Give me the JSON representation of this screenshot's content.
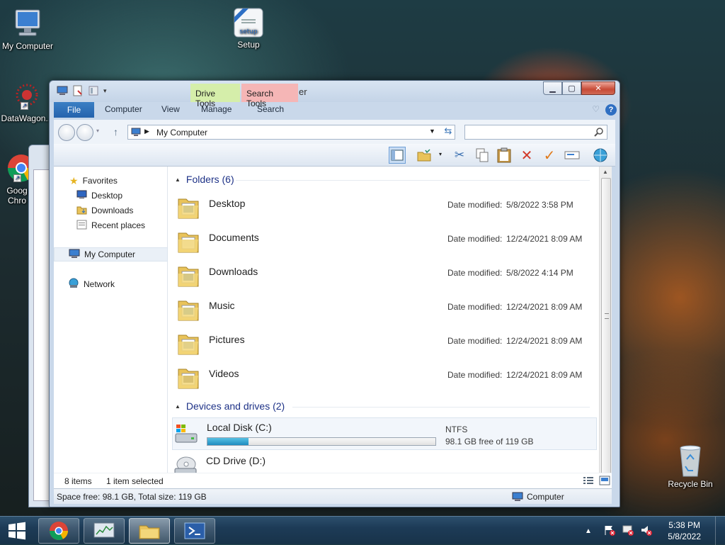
{
  "desktop": {
    "icons": [
      {
        "label": "My Computer"
      },
      {
        "label": "Setup",
        "badge": "setup"
      },
      {
        "label": "DataWagon..."
      },
      {
        "label": "Goog Chro"
      },
      {
        "label": "Recycle Bin"
      }
    ]
  },
  "window": {
    "title_fragment": "er",
    "context_tabs": {
      "drive_tools": "Drive Tools",
      "search_tools": "Search Tools"
    },
    "ribbon_tabs": [
      "File",
      "Computer",
      "View",
      "Manage",
      "Search"
    ],
    "help_label": "?",
    "address": {
      "path": "My Computer"
    },
    "search": {
      "placeholder": ""
    },
    "nav": {
      "favorites": "Favorites",
      "desktop": "Desktop",
      "downloads": "Downloads",
      "recent": "Recent places",
      "my_computer": "My Computer",
      "network": "Network"
    },
    "groups": {
      "folders": "Folders (6)",
      "devices": "Devices and drives (2)"
    },
    "date_label": "Date modified:",
    "folders": [
      {
        "name": "Desktop",
        "date": "5/8/2022 3:58 PM"
      },
      {
        "name": "Documents",
        "date": "12/24/2021 8:09 AM"
      },
      {
        "name": "Downloads",
        "date": "5/8/2022 4:14 PM"
      },
      {
        "name": "Music",
        "date": "12/24/2021 8:09 AM"
      },
      {
        "name": "Pictures",
        "date": "12/24/2021 8:09 AM"
      },
      {
        "name": "Videos",
        "date": "12/24/2021 8:09 AM"
      }
    ],
    "drives": [
      {
        "name": "Local Disk (C:)",
        "fs": "NTFS",
        "free_text": "98.1 GB free of 119 GB",
        "used_fraction": 0.18
      },
      {
        "name": "CD Drive (D:)"
      }
    ],
    "status": {
      "items": "8 items",
      "selected": "1 item selected",
      "space": "Space free: 98.1 GB, Total size: 119 GB",
      "location": "Computer"
    }
  },
  "taskbar": {
    "time": "5:38 PM",
    "date": "5/8/2022"
  }
}
